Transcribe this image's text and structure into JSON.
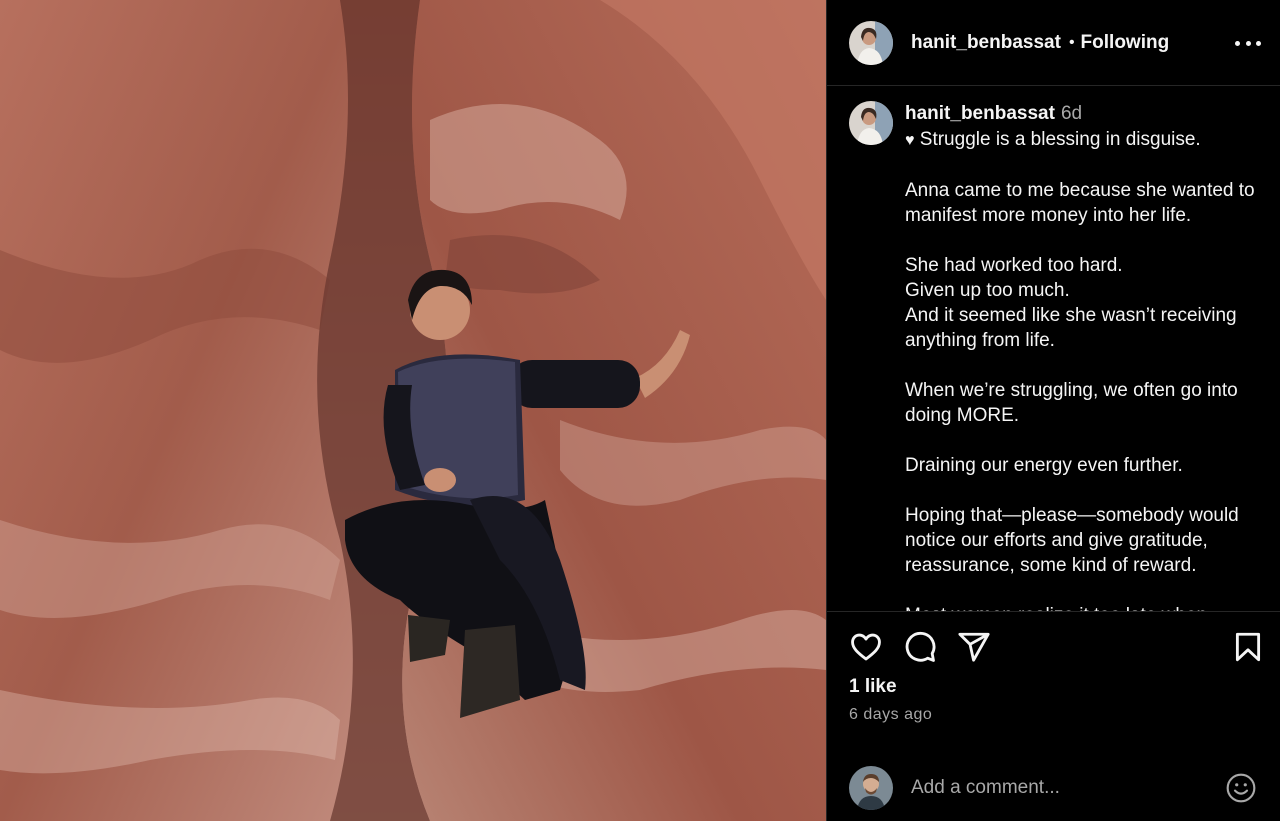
{
  "post": {
    "username": "hanit_benbassat",
    "separator": "•",
    "follow_status": "Following",
    "caption": {
      "time": "6d",
      "heart": "♥",
      "text": " Struggle is a blessing in disguise.\n\nAnna came to me because she wanted to manifest more money into her life.\n\nShe had worked too hard.\nGiven up too much.\nAnd it seemed like she wasn’t receiving anything from life.\n\nWhen we’re struggling, we often go into doing MORE.\n\nDraining our energy even further.\n\nHoping that—please—somebody would notice our efforts and give gratitude, reassurance, some kind of reward.\n\nMost women realize it too late when"
    },
    "likes": "1 like",
    "time_ago": "6 days ago",
    "comment_placeholder": "Add a comment..."
  },
  "icons": {
    "like": "heart-icon",
    "comment": "comment-bubble-icon",
    "share": "paper-plane-icon",
    "save": "bookmark-icon",
    "more": "more-options-icon",
    "emoji": "emoji-icon"
  },
  "colors": {
    "background": "#000000",
    "text": "#f5f5f5",
    "muted": "#a8a8a8",
    "divider": "#262626"
  }
}
